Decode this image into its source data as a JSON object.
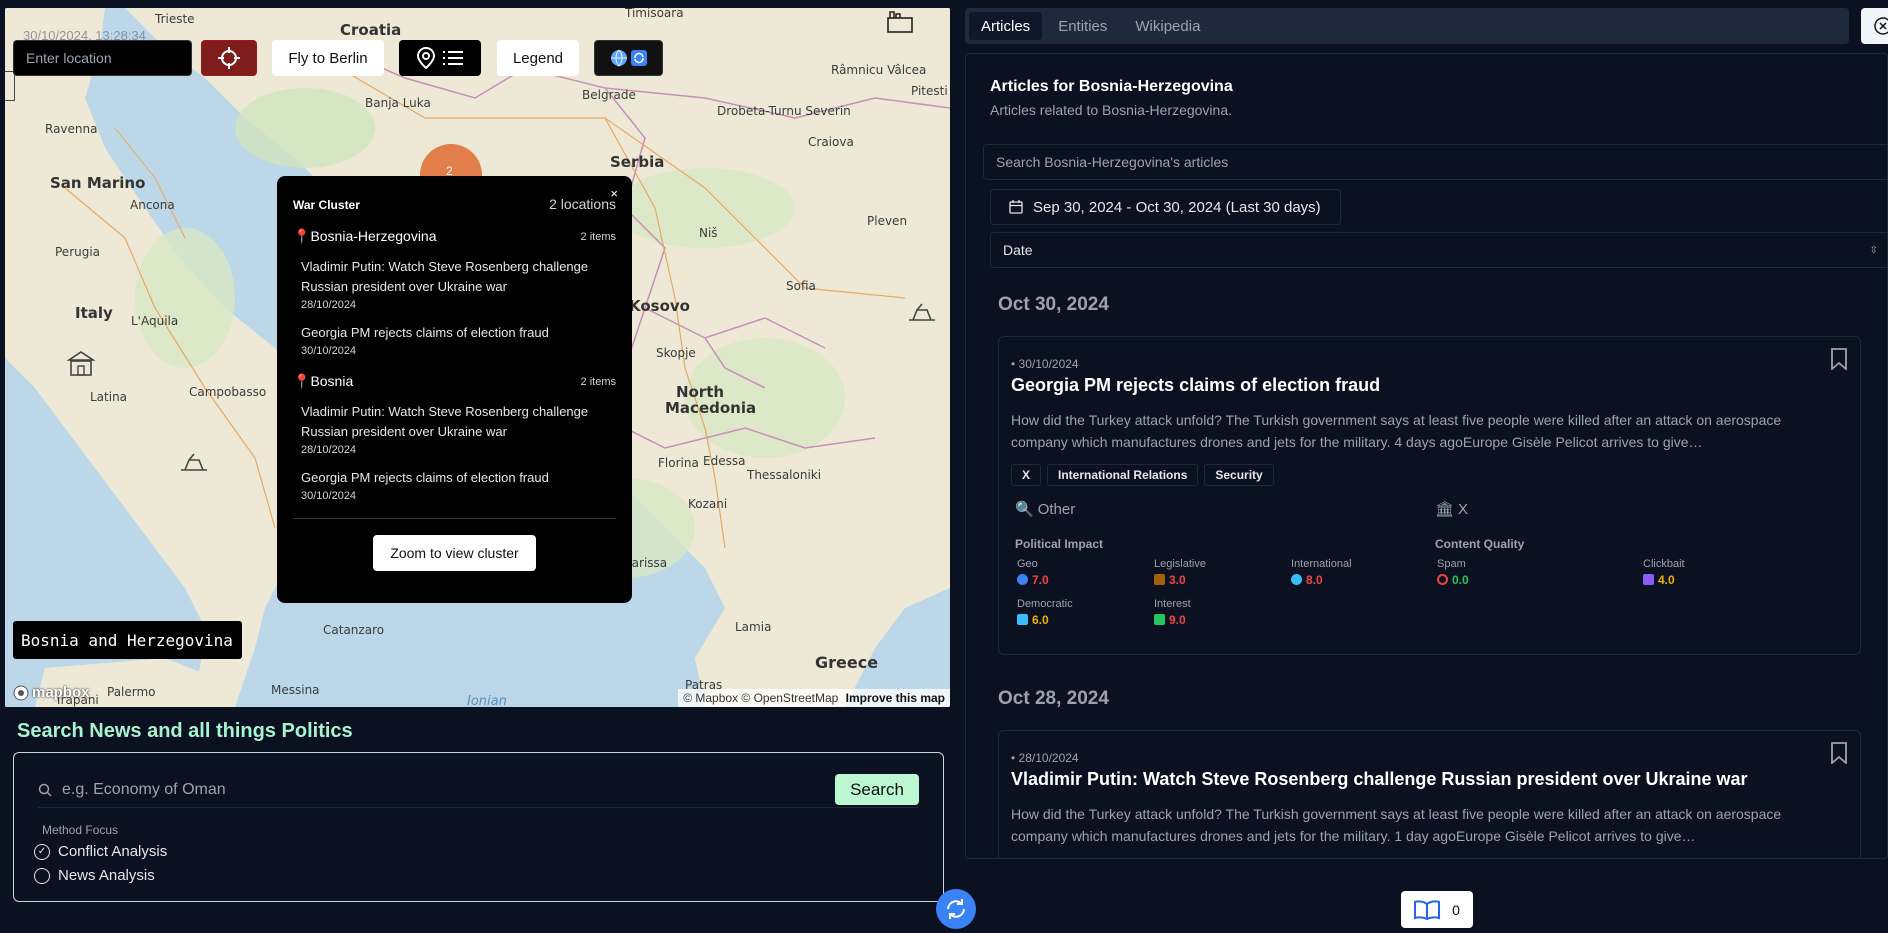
{
  "map": {
    "timestamp": "30/10/2024, 13:28:34",
    "location_placeholder": "Enter location",
    "fly_label": "Fly to Berlin",
    "legend_label": "Legend",
    "country_label": "Bosnia and Herzegovina",
    "logo_text": "mapbox",
    "attribution": "© Mapbox © OpenStreetMap",
    "improve_label": "Improve this map",
    "cluster_count": "2",
    "places": [
      {
        "label": "Trieste",
        "kind": "city"
      },
      {
        "label": "Croatia",
        "kind": "country"
      },
      {
        "label": "Timisoara",
        "kind": "city"
      },
      {
        "label": "Ravenna",
        "kind": "city"
      },
      {
        "label": "Banja Luka",
        "kind": "city"
      },
      {
        "label": "Belgrade",
        "kind": "city"
      },
      {
        "label": "Drobeta-Turnu Severin",
        "kind": "city"
      },
      {
        "label": "Râmnicu Vâlcea",
        "kind": "city"
      },
      {
        "label": "Pitesti",
        "kind": "city"
      },
      {
        "label": "San Marino",
        "kind": "country"
      },
      {
        "label": "Ancona",
        "kind": "city"
      },
      {
        "label": "Serbia",
        "kind": "country"
      },
      {
        "label": "Craiova",
        "kind": "city"
      },
      {
        "label": "Perugia",
        "kind": "city"
      },
      {
        "label": "Niš",
        "kind": "city"
      },
      {
        "label": "Pleven",
        "kind": "city"
      },
      {
        "label": "Italy",
        "kind": "country"
      },
      {
        "label": "L'Aquila",
        "kind": "city"
      },
      {
        "label": "Kosovo",
        "kind": "country"
      },
      {
        "label": "Sofia",
        "kind": "city"
      },
      {
        "label": "Latina",
        "kind": "city"
      },
      {
        "label": "Skopje",
        "kind": "city"
      },
      {
        "label": "North Macedonia",
        "kind": "country"
      },
      {
        "label": "Campobasso",
        "kind": "city"
      },
      {
        "label": "Florina",
        "kind": "city"
      },
      {
        "label": "Edessa",
        "kind": "city"
      },
      {
        "label": "Thessaloniki",
        "kind": "city"
      },
      {
        "label": "Kozani",
        "kind": "city"
      },
      {
        "label": "Larissa",
        "kind": "city"
      },
      {
        "label": "Catanzaro",
        "kind": "city"
      },
      {
        "label": "Lamia",
        "kind": "city"
      },
      {
        "label": "Greece",
        "kind": "country"
      },
      {
        "label": "Palermo",
        "kind": "city"
      },
      {
        "label": "Messina",
        "kind": "city"
      },
      {
        "label": "Patras",
        "kind": "city"
      },
      {
        "label": "Trapani",
        "kind": "city"
      },
      {
        "label": "Ionian",
        "kind": "sea"
      }
    ]
  },
  "popup": {
    "title": "War Cluster",
    "count": "2 locations",
    "close": "×",
    "groups": [
      {
        "name": "Bosnia-Herzegovina",
        "items": "2 items",
        "articles": [
          {
            "title": "Vladimir Putin: Watch Steve Rosenberg challenge Russian president over Ukraine war",
            "date": "28/10/2024"
          },
          {
            "title": "Georgia PM rejects claims of election fraud",
            "date": "30/10/2024"
          }
        ]
      },
      {
        "name": "Bosnia",
        "items": "2 items",
        "articles": [
          {
            "title": "Vladimir Putin: Watch Steve Rosenberg challenge Russian president over Ukraine war",
            "date": "28/10/2024"
          },
          {
            "title": "Georgia PM rejects claims of election fraud",
            "date": "30/10/2024"
          }
        ]
      }
    ],
    "zoom_label": "Zoom to view cluster"
  },
  "search": {
    "title": "Search News and all things Politics",
    "placeholder": "e.g. Economy of Oman",
    "button": "Search",
    "method_label": "Method Focus",
    "methods": [
      {
        "label": "Conflict Analysis",
        "checked": true
      },
      {
        "label": "News Analysis",
        "checked": false
      }
    ]
  },
  "tabs": [
    "Articles",
    "Entities",
    "Wikipedia"
  ],
  "panel": {
    "title": "Articles for Bosnia-Herzegovina",
    "subtitle": "Articles related to Bosnia-Herzegovina.",
    "search_placeholder": "Search Bosnia-Herzegovina's articles",
    "date_range": "Sep 30, 2024 - Oct 30, 2024 (Last 30 days)",
    "sort": "Date",
    "sections": [
      {
        "date": "Oct 30, 2024",
        "article": {
          "date": "30/10/2024",
          "title": "Georgia PM rejects claims of election fraud",
          "body": "How did the Turkey attack unfold? The Turkish government says at least five people were killed after an attack on aerospace company which manufactures drones and jets for the military. 4 days agoEurope Gisèle Pelicot arrives to give…",
          "tags": [
            "X",
            "International Relations",
            "Security"
          ],
          "category_left": "Other",
          "category_right": "X",
          "political_title": "Political Impact",
          "quality_title": "Content Quality",
          "metrics": [
            {
              "label": "Geo",
              "value": "7.0",
              "color": "#ef4444",
              "icon_color": "#3b82f6"
            },
            {
              "label": "Legislative",
              "value": "3.0",
              "color": "#ef4444",
              "icon_color": "#a16207"
            },
            {
              "label": "International",
              "value": "8.0",
              "color": "#ef4444",
              "icon_color": "#38bdf8"
            },
            {
              "label": "Spam",
              "value": "0.0",
              "color": "#22c55e",
              "icon_color": "#ef4444"
            },
            {
              "label": "Clickbait",
              "value": "4.0",
              "color": "#eab308",
              "icon_color": "#8b5cf6"
            },
            {
              "label": "Democratic",
              "value": "6.0",
              "color": "#eab308",
              "icon_color": "#38bdf8"
            },
            {
              "label": "Interest",
              "value": "9.0",
              "color": "#ef4444",
              "icon_color": "#22c55e"
            }
          ]
        }
      },
      {
        "date": "Oct 28, 2024",
        "article": {
          "date": "28/10/2024",
          "title": "Vladimir Putin: Watch Steve Rosenberg challenge Russian president over Ukraine war",
          "body": "How did the Turkey attack unfold? The Turkish government says at least five people were killed after an attack on aerospace company which manufactures drones and jets for the military. 1 day agoEurope Gisèle Pelicot arrives to give…"
        }
      }
    ]
  },
  "bookmarks": {
    "count": "0"
  },
  "colors": {
    "accent_green": "#bbf7d0",
    "locate_red": "#7f1d1d",
    "refresh_blue": "#3b82f6",
    "cluster_orange": "#e0733a"
  }
}
